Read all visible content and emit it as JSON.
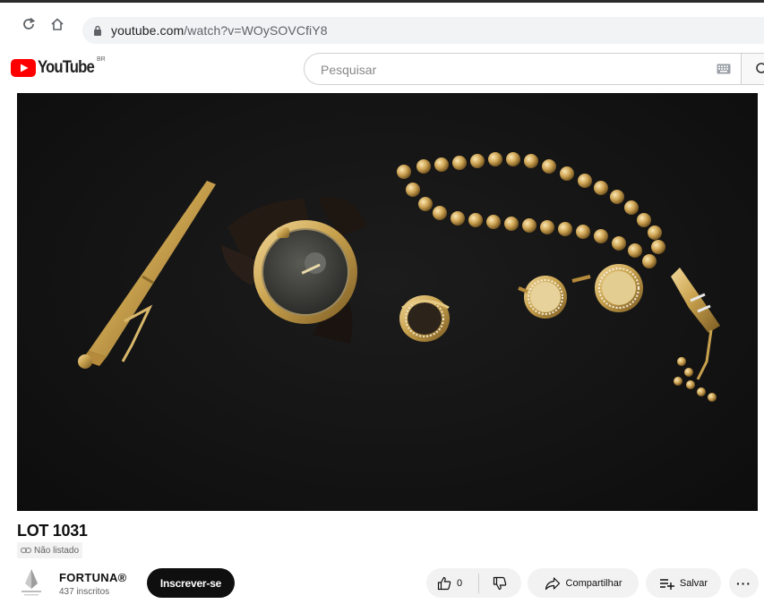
{
  "browser": {
    "url_host": "youtube.com",
    "url_path": "/watch?v=WOySOVCfiY8"
  },
  "header": {
    "logo_text": "YouTube",
    "country_code": "BR",
    "search_placeholder": "Pesquisar"
  },
  "video": {
    "title": "LOT 1031",
    "visibility": "Não listado"
  },
  "channel": {
    "name": "FORTUNA®",
    "subscribers": "437 inscritos",
    "subscribe_label": "Inscrever-se"
  },
  "actions": {
    "like_count": "0",
    "share_label": "Compartilhar",
    "save_label": "Salvar",
    "more_label": "···"
  },
  "colors": {
    "youtube_red": "#ff0000",
    "subscribe_bg": "#0f0f0f",
    "pill_bg": "#f2f2f2",
    "gold": "#c9a24e"
  },
  "icons": [
    "reload-icon",
    "home-icon",
    "lock-icon",
    "youtube-play-icon",
    "keyboard-icon",
    "search-icon",
    "link-icon",
    "like-icon",
    "dislike-icon",
    "share-icon",
    "save-icon",
    "more-icon"
  ]
}
